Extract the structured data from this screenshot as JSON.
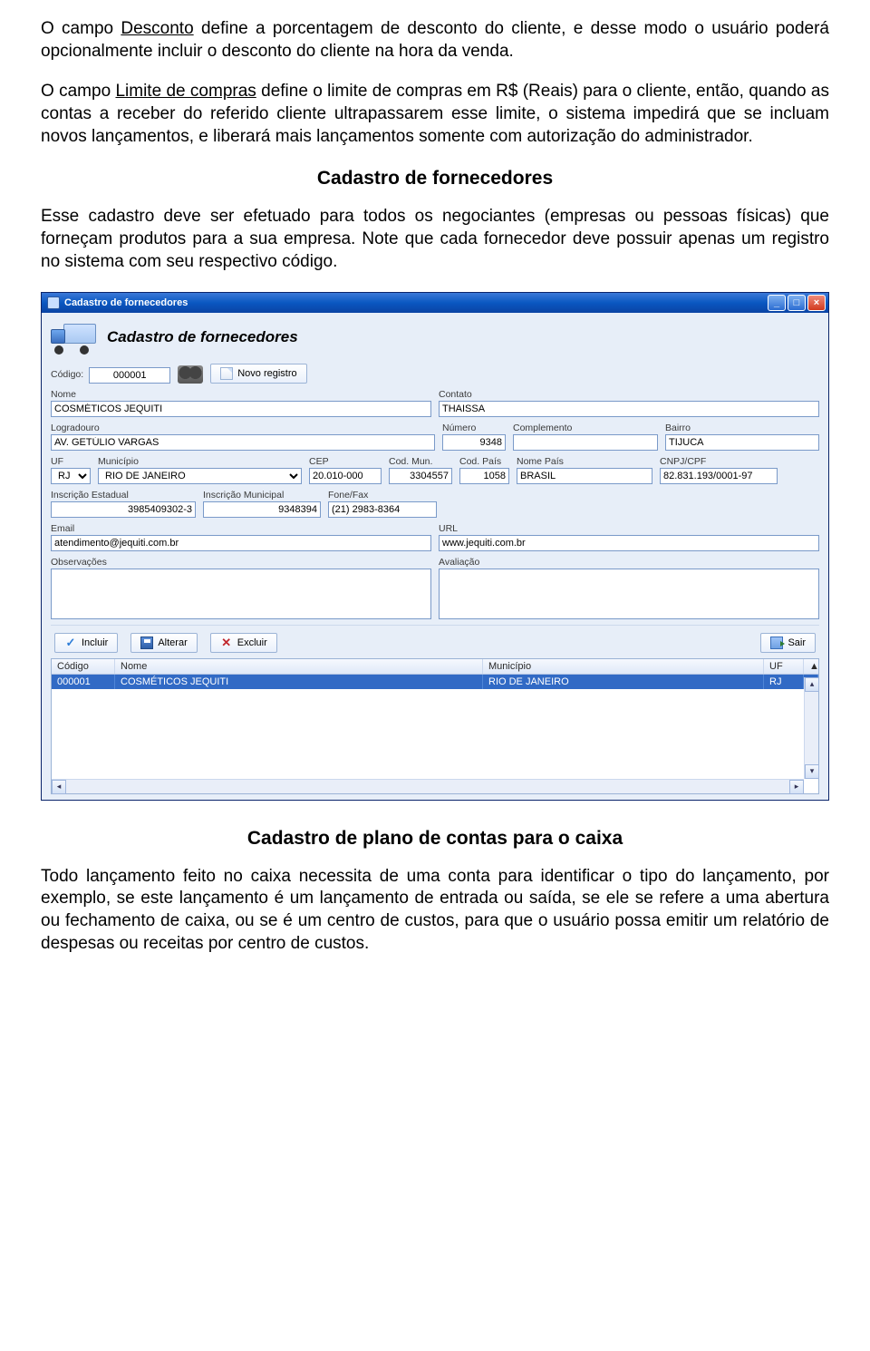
{
  "doc": {
    "para1_pre": "O campo ",
    "para1_u": "Desconto",
    "para1_post": " define a porcentagem de desconto do cliente, e desse modo o usuário poderá opcionalmente incluir o desconto do cliente na hora da venda.",
    "para2_pre": "O campo ",
    "para2_u": "Limite de compras",
    "para2_post": " define o limite de compras em R$ (Reais) para o cliente, então, quando as contas a receber do referido cliente ultrapassarem esse limite, o sistema impedirá que se incluam novos lançamentos, e liberará mais lançamentos somente com autorização do administrador.",
    "heading1": "Cadastro de fornecedores",
    "para3": "Esse cadastro deve ser efetuado para todos os negociantes (empresas ou pessoas físicas) que forneçam produtos para a sua empresa. Note que cada fornecedor deve possuir apenas um registro no sistema com seu respectivo código.",
    "heading2": "Cadastro de plano de contas para o caixa",
    "para4": "Todo lançamento feito no caixa necessita de uma conta para identificar o tipo do lançamento, por exemplo, se este lançamento é um lançamento de entrada ou saída, se ele se refere a uma abertura ou fechamento de caixa, ou se é um centro de custos, para que o usuário possa emitir um relatório de despesas ou receitas por centro de custos."
  },
  "win": {
    "title": "Cadastro de fornecedores",
    "header": "Cadastro de fornecedores",
    "labels": {
      "codigo": "Código:",
      "novo_registro": "Novo registro",
      "nome": "Nome",
      "contato": "Contato",
      "logradouro": "Logradouro",
      "numero": "Número",
      "complemento": "Complemento",
      "bairro": "Bairro",
      "uf": "UF",
      "municipio": "Município",
      "cep": "CEP",
      "cod_mun": "Cod. Mun.",
      "cod_pais": "Cod. País",
      "nome_pais": "Nome País",
      "cnpj_cpf": "CNPJ/CPF",
      "insc_est": "Inscrição Estadual",
      "insc_mun": "Inscrição Municipal",
      "fone_fax": "Fone/Fax",
      "email": "Email",
      "url": "URL",
      "obs": "Observações",
      "aval": "Avaliação"
    },
    "values": {
      "codigo": "000001",
      "nome": "COSMÉTICOS JEQUITI",
      "contato": "THAISSA",
      "logradouro": "AV. GETÚLIO VARGAS",
      "numero": "9348",
      "complemento": "",
      "bairro": "TIJUCA",
      "uf": "RJ",
      "municipio": "RIO DE JANEIRO",
      "cep": "20.010-000",
      "cod_mun": "3304557",
      "cod_pais": "1058",
      "nome_pais": "BRASIL",
      "cnpj_cpf": "82.831.193/0001-97",
      "insc_est": "3985409302-3",
      "insc_mun": "9348394",
      "fone_fax": "(21) 2983-8364",
      "email": "atendimento@jequiti.com.br",
      "url": "www.jequiti.com.br",
      "obs": "",
      "aval": ""
    },
    "actions": {
      "incluir": "Incluir",
      "alterar": "Alterar",
      "excluir": "Excluir",
      "sair": "Sair"
    },
    "grid": {
      "headers": {
        "codigo": "Código",
        "nome": "Nome",
        "municipio": "Município",
        "uf": "UF"
      },
      "row": {
        "codigo": "000001",
        "nome": "COSMÉTICOS JEQUITI",
        "municipio": "RIO DE JANEIRO",
        "uf": "RJ"
      }
    }
  }
}
